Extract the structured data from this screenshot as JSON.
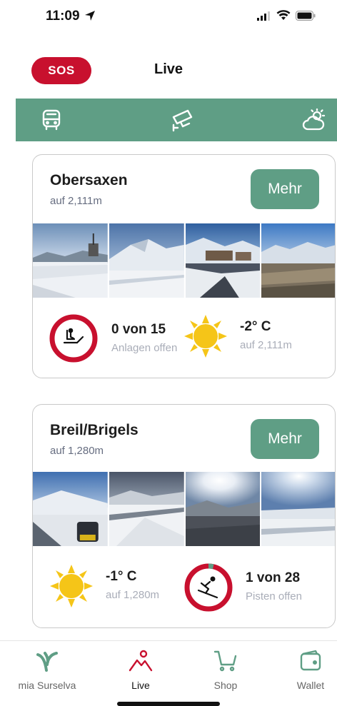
{
  "status_bar": {
    "time": "11:09"
  },
  "header": {
    "sos_label": "SOS",
    "title": "Live"
  },
  "tabs": [
    {
      "icon": "bus-icon"
    },
    {
      "icon": "webcam-icon"
    },
    {
      "icon": "weather-icon"
    }
  ],
  "cards": [
    {
      "title": "Obersaxen",
      "altitude": "auf 2,111m",
      "more_label": "Mehr",
      "lifts": {
        "value": "0 von 15",
        "label": "Anlagen offen",
        "open_fraction": 0.0
      },
      "weather": {
        "value": "-2° C",
        "label": "auf 2,111m",
        "icon": "sun-icon"
      }
    },
    {
      "title": "Breil/Brigels",
      "altitude": "auf 1,280m",
      "more_label": "Mehr",
      "weather": {
        "value": "-1° C",
        "label": "auf 1,280m",
        "icon": "sun-icon"
      },
      "pistes": {
        "value": "1 von 28",
        "label": "Pisten offen",
        "open_fraction": 0.036
      }
    }
  ],
  "bottom_nav": [
    {
      "label": "mia Surselva",
      "icon": "surselva-logo-icon"
    },
    {
      "label": "Live",
      "icon": "mountain-pin-icon",
      "active": true
    },
    {
      "label": "Shop",
      "icon": "cart-icon"
    },
    {
      "label": "Wallet",
      "icon": "wallet-icon"
    }
  ],
  "colors": {
    "accent": "#5f9e85",
    "sos": "#c8102e",
    "closed": "#c8102e",
    "open": "#5f9e85",
    "sun": "#f5c518"
  }
}
